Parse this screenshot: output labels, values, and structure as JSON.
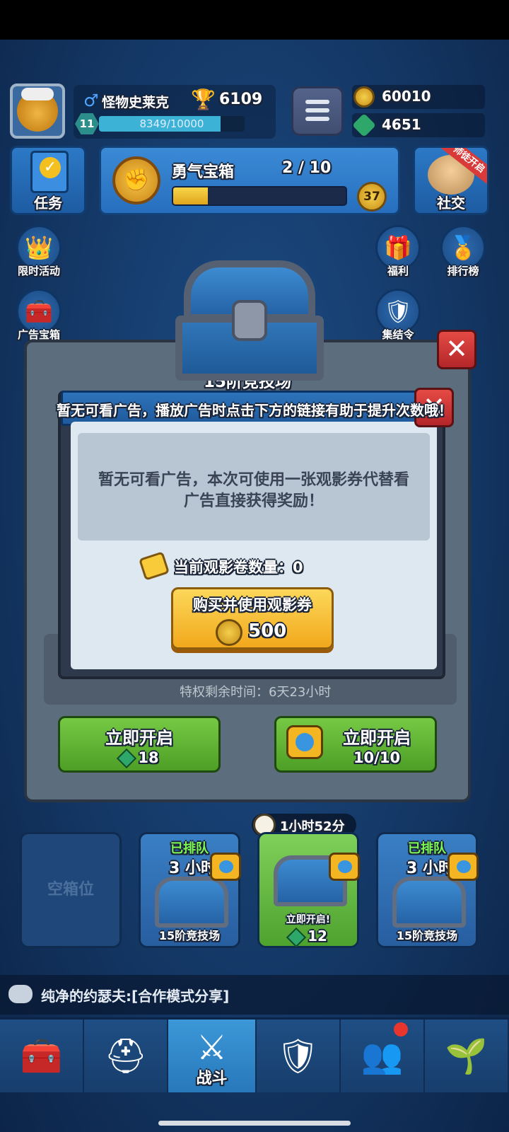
{
  "player": {
    "name": "怪物史莱克",
    "trophies": "6109",
    "level": "11",
    "xp_text": "8349/10000",
    "xp_progress": 0.8349
  },
  "resources": {
    "coins": "60010",
    "gems": "4651"
  },
  "tasks": {
    "label": "任务"
  },
  "brave_chest": {
    "title": "勇气宝箱",
    "count": "2 / 10",
    "progress": 0.2,
    "coin_badge": "37"
  },
  "social": {
    "label": "社交",
    "ribbon": "师徒开启"
  },
  "side_icons": {
    "limited_event": "限时活动",
    "ad_chest": "广告宝箱",
    "welfare": "福利",
    "leaderboard": "排行榜",
    "rally": "集结令"
  },
  "background_panel": {
    "title": "15阶竞技场",
    "privilege_text": "特权剩余时间：6天23小时",
    "open_now_label": "立即开启",
    "gem_cost": "18",
    "ad_open_label": "立即开启",
    "ad_count": "10/10"
  },
  "toast": "暂无可看广告，播放广告时点击下方的链接有助于提升次数哦！",
  "modal": {
    "message": "暂无可看广告，本次可使用一张观影券代替看广告直接获得奖励！",
    "ticket_label": "当前观影卷数量：0",
    "buy_label": "购买并使用观影券",
    "buy_price": "500"
  },
  "timer": "1小时52分",
  "slots": [
    {
      "type": "empty",
      "label": "空箱位"
    },
    {
      "type": "chest",
      "queued": "已排队",
      "hours": "3 小时",
      "arena": "15阶竞技场"
    },
    {
      "type": "active",
      "open_now": "立即开启!",
      "cost": "12"
    },
    {
      "type": "chest",
      "queued": "已排队",
      "hours": "3 小时",
      "arena": "15阶竞技场"
    }
  ],
  "chat": {
    "message": "纯净的约瑟夫:[合作模式分享]"
  },
  "nav": {
    "battle_label": "战斗"
  },
  "colors": {
    "background": "#143866",
    "accent_green": "#4ea22e",
    "accent_gold": "#f2a81c",
    "close_red": "#d83a3a"
  }
}
